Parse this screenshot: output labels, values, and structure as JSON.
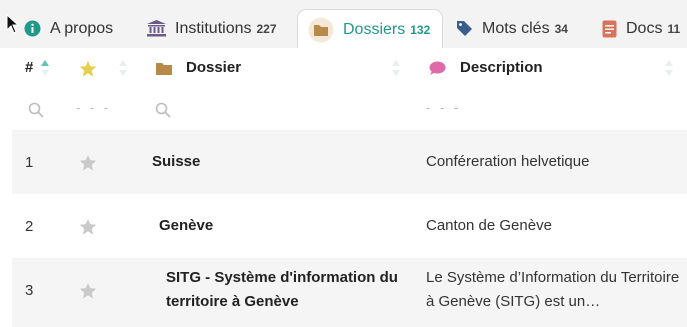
{
  "tabs": [
    {
      "label": "A propos",
      "count": "",
      "icon": "info-icon",
      "color": "#1f9a8a"
    },
    {
      "label": "Institutions",
      "count": "227",
      "icon": "institution-icon",
      "color": "#6a5a8c"
    },
    {
      "label": "Dossiers",
      "count": "132",
      "icon": "folder-icon",
      "color": "#b88a4a",
      "active": true
    },
    {
      "label": "Mots clés",
      "count": "34",
      "icon": "tag-icon",
      "color": "#3a5f8c"
    },
    {
      "label": "Docs",
      "count": "11",
      "icon": "document-icon",
      "color": "#d9725a"
    }
  ],
  "table": {
    "headers": {
      "number": "#",
      "dossier": "Dossier",
      "description": "Description"
    },
    "filters": {
      "star_placeholder": "- - -",
      "description_placeholder": "- - -"
    },
    "rows": [
      {
        "number": "1",
        "dossier": "Suisse",
        "description": "Conféreration helvetique"
      },
      {
        "number": "2",
        "dossier": "Genève",
        "description": "Canton de Genève"
      },
      {
        "number": "3",
        "dossier": "SITG - Système d'information du territoire à Genève",
        "description": "Le Système d’Information du Territoire à Genève (SITG) est un…"
      }
    ]
  },
  "colors": {
    "accent": "#1f9a8a",
    "folder": "#b88a4a",
    "star_header": "#e6cf4f",
    "star_row": "#c9c9c9",
    "description_icon": "#e06aa8"
  }
}
